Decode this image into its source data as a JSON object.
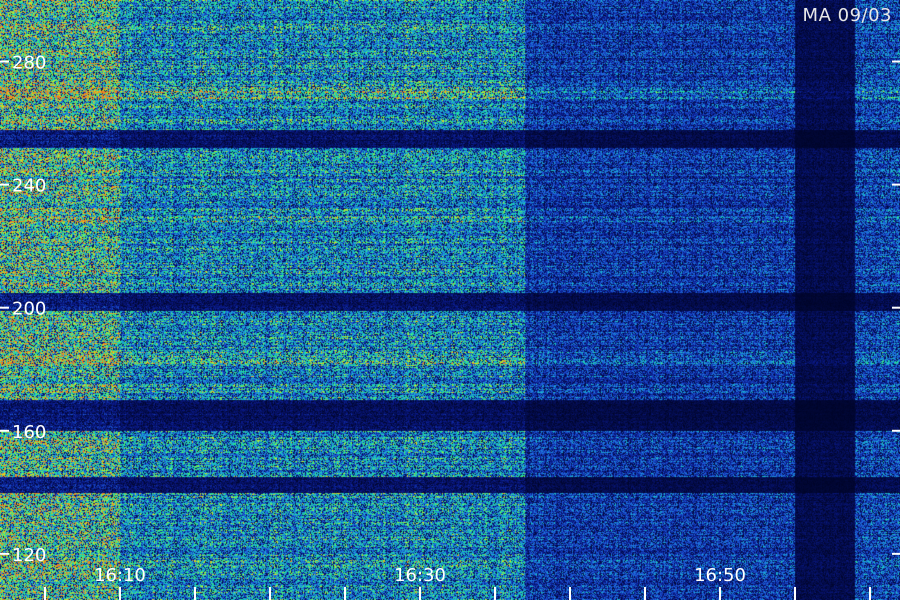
{
  "station_label": "MA 09/03",
  "chart_data": {
    "type": "heatmap",
    "title": "",
    "xlabel": "",
    "ylabel": "",
    "colormap": [
      "#000428",
      "#0a1a8c",
      "#1f5fe0",
      "#19c0d0",
      "#2df080",
      "#d8f020",
      "#f08020"
    ],
    "y_axis": {
      "ticks": [
        120,
        160,
        200,
        240,
        280
      ],
      "range": [
        105,
        300
      ],
      "tick_side": "left"
    },
    "x_axis": {
      "ticks": [
        "16:10",
        "16:30",
        "16:50"
      ],
      "range": [
        "16:02",
        "17:02"
      ],
      "minor_tick_step_min": 5
    },
    "activity_segments": [
      {
        "start": "16:02",
        "end": "16:10",
        "intensity": 0.85
      },
      {
        "start": "16:10",
        "end": "16:37",
        "intensity": 0.6
      },
      {
        "start": "16:37",
        "end": "16:55",
        "intensity": 0.35
      },
      {
        "start": "16:55",
        "end": "16:59",
        "intensity": 0.1
      },
      {
        "start": "16:59",
        "end": "17:02",
        "intensity": 0.4
      }
    ],
    "dark_bands_freq": [
      [
        252,
        258
      ],
      [
        199,
        205
      ],
      [
        160,
        170
      ],
      [
        140,
        145
      ]
    ],
    "bright_bands_freq": [
      [
        228,
        230
      ],
      [
        268,
        272
      ],
      [
        182,
        186
      ]
    ]
  }
}
